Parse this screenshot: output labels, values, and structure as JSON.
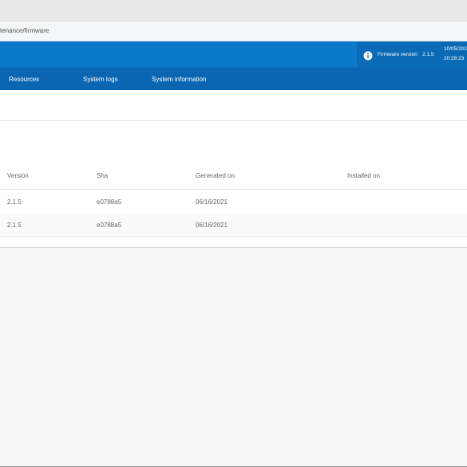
{
  "browser": {
    "url": "tenance/firmware"
  },
  "header": {
    "firmware_label": "Firmware version",
    "firmware_version": "2.1.5",
    "date": "10/05/202",
    "time": "20:28:23"
  },
  "nav": {
    "items": [
      {
        "label": "Resources"
      },
      {
        "label": "System logs"
      },
      {
        "label": "System information"
      }
    ]
  },
  "table": {
    "columns": [
      "Version",
      "Sha",
      "Generated on",
      "Installed on"
    ],
    "rows": [
      {
        "version": "2.1.5",
        "sha": "e0788a5",
        "generated_on": "06/16/2021",
        "installed_on": ""
      },
      {
        "version": "2.1.5",
        "sha": "e0788a5",
        "generated_on": "06/16/2021",
        "installed_on": ""
      }
    ]
  },
  "colors": {
    "header_blue": "#0b79c9",
    "nav_blue": "#0a65b3"
  },
  "icons": {
    "info": "info-icon"
  }
}
